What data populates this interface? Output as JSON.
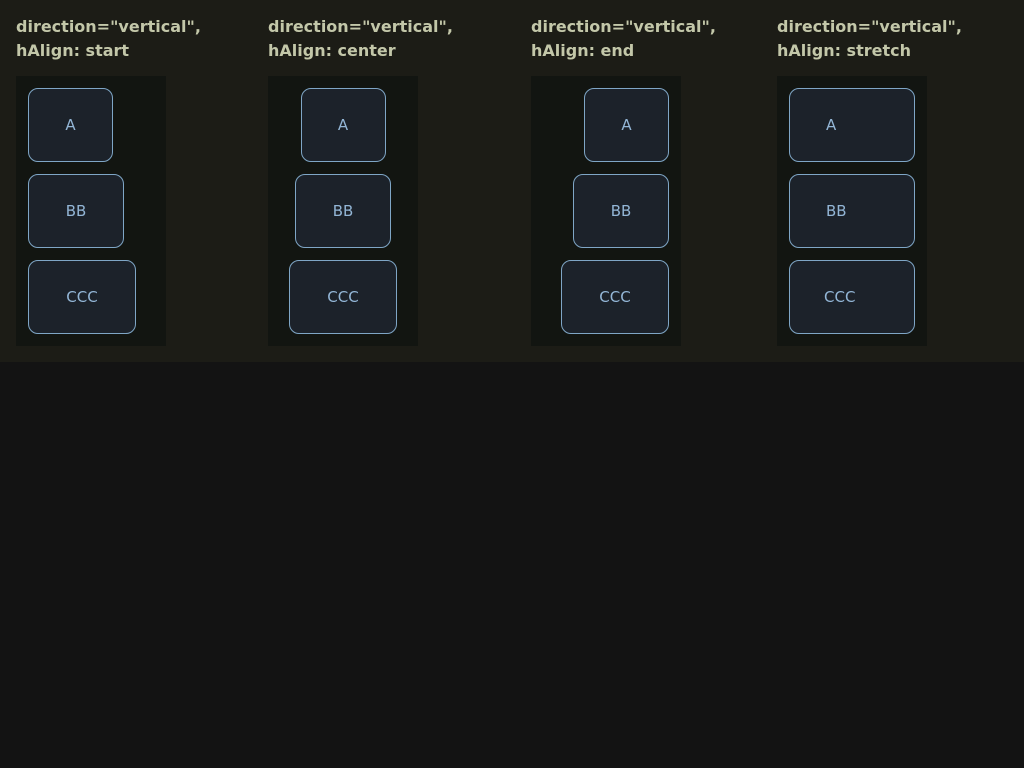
{
  "columns": [
    {
      "title_line1": "direction=\"vertical\",",
      "title_line2": "hAlign: start",
      "items": [
        "A",
        "BB",
        "CCC"
      ]
    },
    {
      "title_line1": "direction=\"vertical\",",
      "title_line2": "hAlign: center",
      "items": [
        "A",
        "BB",
        "CCC"
      ]
    },
    {
      "title_line1": "direction=\"vertical\",",
      "title_line2": "hAlign: end",
      "items": [
        "A",
        "BB",
        "CCC"
      ]
    },
    {
      "title_line1": "direction=\"vertical\",",
      "title_line2": "hAlign: stretch",
      "items": [
        "A",
        "BB",
        "CCC"
      ]
    }
  ],
  "colors": {
    "band_background": "#1c1c16",
    "page_background": "#131313",
    "stack_background": "#121511",
    "title_text": "#c3c7a9",
    "box_border": "#7fa6c6",
    "box_fill": "#1c222a",
    "box_text": "#93b6d6"
  }
}
